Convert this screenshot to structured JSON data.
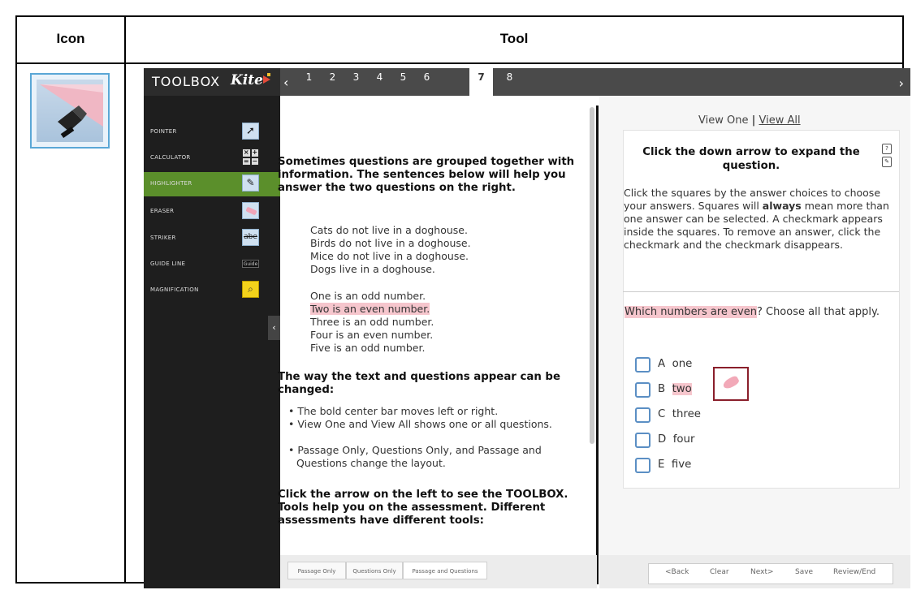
{
  "table": {
    "headers": [
      "Icon",
      "Tool"
    ]
  },
  "toolbox": {
    "title": "TOOLBOX",
    "logo": "Kite"
  },
  "nav": {
    "tabs": [
      "1",
      "2",
      "3",
      "4",
      "5",
      "6",
      "7",
      "8"
    ],
    "active_tab": "7",
    "prev_icon": "chevron-left-icon",
    "next_icon": "chevron-right-icon"
  },
  "tools": [
    {
      "label": "POINTER",
      "icon": "pointer-icon"
    },
    {
      "label": "CALCULATOR",
      "icon": "calculator-icon"
    },
    {
      "label": "HIGHLIGHTER",
      "icon": "highlighter-icon",
      "active": true
    },
    {
      "label": "ERASER",
      "icon": "eraser-icon"
    },
    {
      "label": "STRIKER",
      "icon": "striker-icon"
    },
    {
      "label": "GUIDE LINE",
      "icon": "guide-line-icon"
    },
    {
      "label": "MAGNIFICATION",
      "icon": "magnification-icon"
    }
  ],
  "calc_keys": [
    "×",
    "+",
    "=",
    "−"
  ],
  "striker_glyph": "abe",
  "guide_glyph": "Guide",
  "passage": {
    "intro": "Sometimes questions are grouped together with information. The sentences below will help you answer the two questions on the right.",
    "group1": [
      "Cats do not live in a doghouse.",
      "Birds do not live in a doghouse.",
      "Mice do not live in a doghouse.",
      "Dogs live in a doghouse."
    ],
    "group2": [
      "One is an odd number.",
      "Two is an even number.",
      "Three is an odd number.",
      "Four is an even number.",
      "Five is an odd number."
    ],
    "highlighted_line": "Two is an even number.",
    "heading2": "The way the text and questions appear can be changed:",
    "bullets": [
      "The bold center bar moves left or right.",
      "View One and View All shows one or all questions.",
      "Passage Only, Questions Only, and Passage and Questions change the layout."
    ],
    "footer": "Click the arrow on the left to see the TOOLBOX. Tools help you on the assessment. Different assessments have different tools:"
  },
  "question": {
    "view_one": "View One",
    "separator": "|",
    "view_all": "View All",
    "heading": "Click the down arrow to expand the question.",
    "instructions_pre": "Click the squares by the answer choices to choose your answers. Squares will ",
    "instructions_bold": "always",
    "instructions_post": " mean more than one answer can be selected. A checkmark appears inside the squares. To remove an answer, click the checkmark and the checkmark disappears.",
    "prompt_highlight": "Which numbers are even",
    "prompt_rest": "? Choose all that apply.",
    "choices": [
      {
        "letter": "A",
        "text": "one"
      },
      {
        "letter": "B",
        "text": "two",
        "highlighted": true
      },
      {
        "letter": "C",
        "text": "three"
      },
      {
        "letter": "D",
        "text": "four"
      },
      {
        "letter": "E",
        "text": "five"
      }
    ]
  },
  "layout_buttons": [
    "Passage Only",
    "Questions Only",
    "Passage and Questions"
  ],
  "nav_buttons": [
    "<Back",
    "Clear",
    "Next>",
    "Save",
    "Review/End"
  ],
  "colors": {
    "highlight": "#f6c6cd",
    "sidebar_active": "#5b8f2b",
    "checkbox_border": "#5b8fc4"
  }
}
